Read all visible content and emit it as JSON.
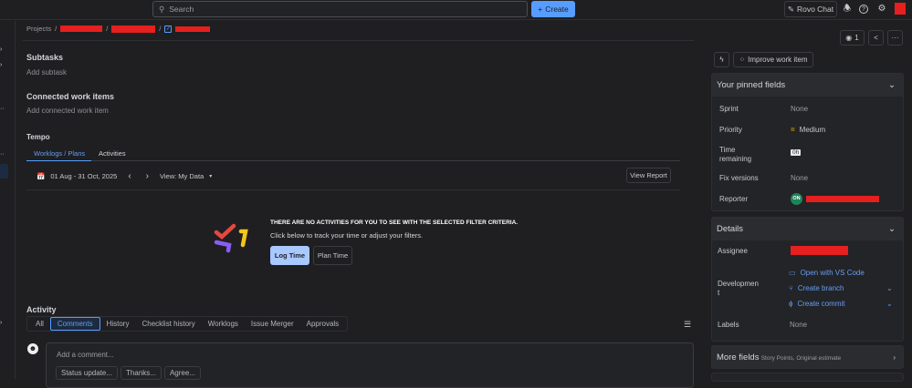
{
  "topbar": {
    "search_placeholder": "Search",
    "create_label": "Create",
    "rovo_label": "Rovo Chat"
  },
  "breadcrumb": {
    "root": "Projects",
    "sep": "/"
  },
  "subtasks": {
    "title": "Subtasks",
    "add": "Add subtask"
  },
  "connected": {
    "title": "Connected work items",
    "add": "Add connected work item"
  },
  "tempo": {
    "title": "Tempo",
    "tabs": [
      "Worklogs / Plans",
      "Activities"
    ],
    "date_range": "01 Aug - 31 Oct, 2025",
    "view": "View: My Data",
    "view_report": "View Report",
    "empty_title": "THERE ARE NO ACTIVITIES FOR YOU TO SEE WITH THE SELECTED FILTER CRITERIA.",
    "empty_sub": "Click below to track your time or adjust your filters.",
    "log_time": "Log Time",
    "plan_time": "Plan Time"
  },
  "activity": {
    "title": "Activity",
    "tabs": [
      "All",
      "Comments",
      "History",
      "Checklist history",
      "Worklogs",
      "Issue Merger",
      "Approvals"
    ],
    "comment_placeholder": "Add a comment...",
    "quick_replies": [
      "Status update...",
      "Thanks...",
      "Agree..."
    ]
  },
  "side": {
    "watchers": "1",
    "improve": "Improve work item",
    "pinned_title": "Your pinned fields",
    "pinned": {
      "sprint_label": "Sprint",
      "sprint": "None",
      "priority_label": "Priority",
      "priority": "Medium",
      "time_label": "Time remaining",
      "time": "0h",
      "fix_label": "Fix versions",
      "fix": "None",
      "reporter_label": "Reporter",
      "reporter_initials": "ON"
    },
    "details_title": "Details",
    "details": {
      "assignee_label": "Assignee",
      "development_label": "Development",
      "vscode": "Open with VS Code",
      "branch": "Create branch",
      "commit": "Create commit",
      "labels_label": "Labels",
      "labels": "None"
    },
    "more_title": "More fields",
    "more_sub": "Story Points, Original estimate"
  },
  "colors": {
    "accent": "#579dff",
    "redaction": "#e5201f",
    "priority": "#e2a500",
    "reporter_avatar": "#1f845a"
  }
}
